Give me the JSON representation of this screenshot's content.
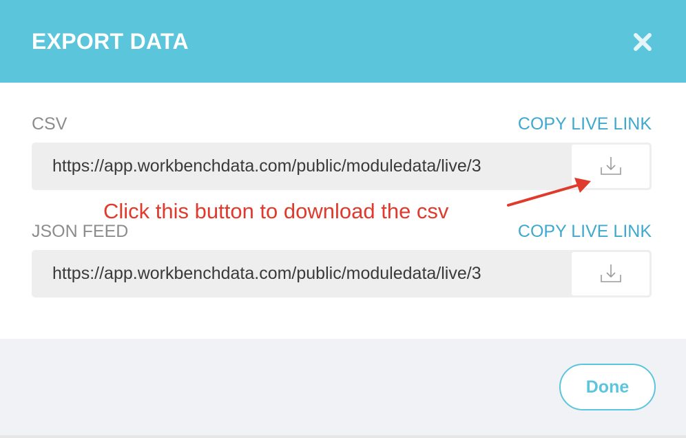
{
  "dialog": {
    "title": "EXPORT DATA",
    "close_icon": "close-icon"
  },
  "csv": {
    "label": "CSV",
    "copy_link_label": "COPY LIVE LINK",
    "url": "https://app.workbenchdata.com/public/moduledata/live/3",
    "download_icon": "download-icon"
  },
  "json_feed": {
    "label": "JSON FEED",
    "copy_link_label": "COPY LIVE LINK",
    "url": "https://app.workbenchdata.com/public/moduledata/live/3",
    "download_icon": "download-icon"
  },
  "annotation": {
    "text": "Click this button to download the csv",
    "color": "#e03a2c"
  },
  "footer": {
    "done_label": "Done"
  },
  "colors": {
    "header": "#5bc5db",
    "link": "#3fa8cf",
    "footer": "#f0f2f6"
  }
}
